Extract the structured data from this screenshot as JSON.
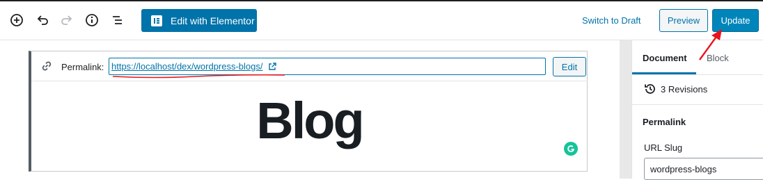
{
  "toolbar": {
    "elementor_label": "Edit with Elementor",
    "switch_draft_label": "Switch to Draft",
    "preview_label": "Preview",
    "update_label": "Update",
    "icons": [
      "add-block-icon",
      "undo-icon",
      "redo-icon",
      "info-icon",
      "list-view-icon"
    ]
  },
  "editor": {
    "permalink_label": "Permalink:",
    "permalink_url": "https://localhost/dex/wordpress-blogs/",
    "edit_label": "Edit",
    "title": "Blog"
  },
  "sidebar": {
    "tabs": [
      {
        "label": "Document",
        "active": true
      },
      {
        "label": "Block",
        "active": false
      }
    ],
    "revisions_label": "3 Revisions",
    "permalink_heading": "Permalink",
    "slug_label": "URL Slug",
    "slug_value": "wordpress-blogs"
  },
  "colors": {
    "accent": "#0073aa",
    "update_bg": "#0085ba",
    "annotation_red": "#e8141b",
    "grammarly": "#15c39a"
  }
}
